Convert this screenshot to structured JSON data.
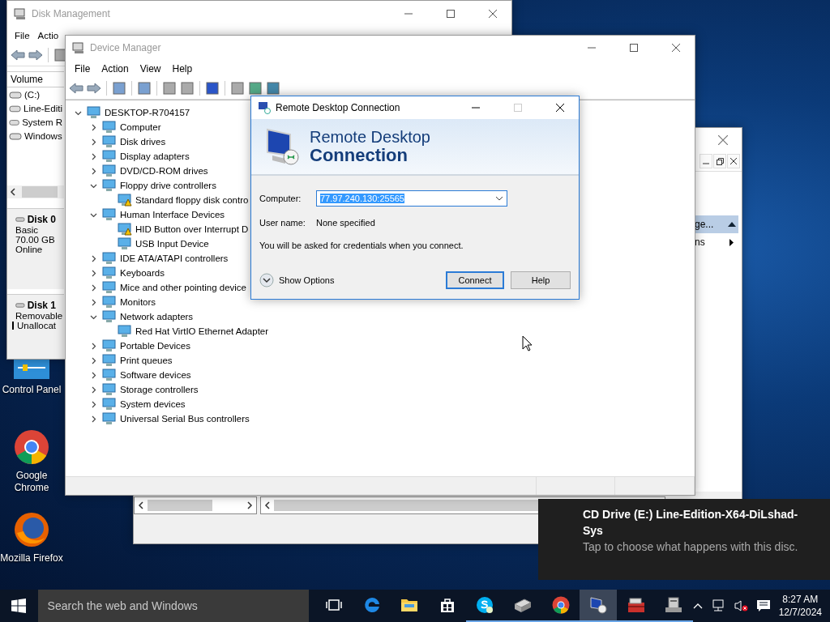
{
  "desktop_icons": [
    {
      "kind": "control-panel",
      "label": "Control Panel"
    },
    {
      "kind": "chrome",
      "label": "Google Chrome"
    },
    {
      "kind": "firefox",
      "label": "Mozilla Firefox"
    }
  ],
  "disk_management": {
    "title": "Disk Management",
    "menu": [
      "File",
      "Actio"
    ],
    "volume_header": "Volume",
    "volumes": [
      "(C:)",
      "Line-Editi",
      "System R",
      "Windows"
    ],
    "disks": [
      {
        "name": "Disk 0",
        "lines": [
          "Basic",
          "70.00 GB",
          "Online"
        ]
      },
      {
        "name": "Disk 1",
        "lines": [
          "Removable"
        ],
        "legend": "Unallocat"
      }
    ]
  },
  "back_window": {
    "action_header": "ge...",
    "action_item": "ns"
  },
  "device_manager": {
    "title": "Device Manager",
    "menu": [
      "File",
      "Action",
      "View",
      "Help"
    ],
    "tree": {
      "label": "DESKTOP-R704157",
      "expanded": true,
      "children": [
        {
          "label": "Computer",
          "expanded": false
        },
        {
          "label": "Disk drives",
          "expanded": false
        },
        {
          "label": "Display adapters",
          "expanded": false
        },
        {
          "label": "DVD/CD-ROM drives",
          "expanded": false
        },
        {
          "label": "Floppy drive controllers",
          "expanded": true,
          "children": [
            {
              "label": "Standard floppy disk contro",
              "warning": true
            }
          ]
        },
        {
          "label": "Human Interface Devices",
          "expanded": true,
          "children": [
            {
              "label": "HID Button over Interrupt D",
              "warning": true
            },
            {
              "label": "USB Input Device",
              "warning": false
            }
          ]
        },
        {
          "label": "IDE ATA/ATAPI controllers",
          "expanded": false
        },
        {
          "label": "Keyboards",
          "expanded": false
        },
        {
          "label": "Mice and other pointing device",
          "expanded": false
        },
        {
          "label": "Monitors",
          "expanded": false
        },
        {
          "label": "Network adapters",
          "expanded": true,
          "children": [
            {
              "label": "Red Hat VirtIO Ethernet Adapter",
              "warning": false
            }
          ]
        },
        {
          "label": "Portable Devices",
          "expanded": false
        },
        {
          "label": "Print queues",
          "expanded": false
        },
        {
          "label": "Software devices",
          "expanded": false
        },
        {
          "label": "Storage controllers",
          "expanded": false
        },
        {
          "label": "System devices",
          "expanded": false
        },
        {
          "label": "Universal Serial Bus controllers",
          "expanded": false
        }
      ]
    }
  },
  "remote_desktop": {
    "title": "Remote Desktop Connection",
    "maximize_disabled": true,
    "banner_line_1": "Remote Desktop",
    "banner_line_2": "Connection",
    "computer_label": "Computer:",
    "computer_value": "77.97.240.130:25565",
    "value_selected": true,
    "username_label": "User name:",
    "username_value": "None specified",
    "info": "You will be asked for credentials when you connect.",
    "show_options": "Show Options",
    "buttons": [
      {
        "label": "Connect",
        "default": true
      },
      {
        "label": "Help",
        "default": false
      }
    ]
  },
  "notification": {
    "title": "CD Drive (E:) Line-Edition-X64-DiLshad-Sys",
    "body": "Tap to choose what happens with this disc."
  },
  "taskbar": {
    "search_placeholder": "Search the web and Windows",
    "apps": [
      {
        "kind": "task-view",
        "running": false,
        "selected": false
      },
      {
        "kind": "edge",
        "running": false,
        "selected": false
      },
      {
        "kind": "folder",
        "running": false,
        "selected": false
      },
      {
        "kind": "store",
        "running": false,
        "selected": false
      },
      {
        "kind": "skype",
        "running": true,
        "selected": false
      },
      {
        "kind": "tool",
        "running": true,
        "selected": false
      },
      {
        "kind": "chrome",
        "running": true,
        "selected": false
      },
      {
        "kind": "remote",
        "running": true,
        "selected": true
      },
      {
        "kind": "toolbox",
        "running": true,
        "selected": false
      },
      {
        "kind": "server",
        "running": true,
        "selected": false
      }
    ],
    "volume_muted": true,
    "time": "8:27 AM",
    "date": "12/7/2024"
  }
}
